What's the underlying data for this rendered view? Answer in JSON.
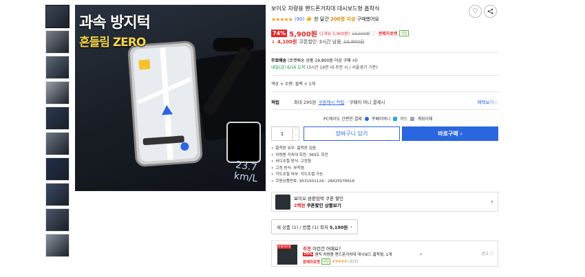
{
  "hero": {
    "headline1": "과속 방지턱",
    "headline2": "흔들림 ZERO",
    "speed_display": "23.7 km/L"
  },
  "thumbnails": [
    {
      "color": "#3a4656"
    },
    {
      "color": "#7a7f88"
    },
    {
      "color": "#5d6a7a"
    },
    {
      "color": "#9aa0a8"
    },
    {
      "color": "#2a3850"
    },
    {
      "color": "#6b7685"
    },
    {
      "color": "#1f2e4a"
    },
    {
      "color": "#3b4a64"
    },
    {
      "color": "#4a5668"
    },
    {
      "color": "#8a93a0"
    }
  ],
  "product": {
    "title": "보이오 차량용 핸드폰거치대 대시보드형 흡착식",
    "rating_stars": "★★★★★",
    "review_count": "(90)",
    "buy_note_prefix": "한 달간",
    "buy_note_count": "200명 이상",
    "buy_note_suffix": "구매했어요",
    "discount": "74%",
    "price": "5,900원",
    "unit_price": "(1개당 5,900원)",
    "original_price": "23,500원",
    "rocket_label": "판매자로켓",
    "rocket_sub": "내일",
    "coupon_arrow": "↓",
    "coupon_price": "4,100원",
    "coupon_label": "쿠폰할인",
    "coupon_time": "3시간 남음",
    "coupon_orig": "10,800원"
  },
  "shipping": {
    "label": "무료배송",
    "condition": "(로켓배송 상품 19,800원 이상 구매 시)",
    "arrival_green": "내일(금) 6/16 도착",
    "arrival_note": "(3시간 19분 내 주문 시 / 서울경기 기준)"
  },
  "options_text": "색상 × 수량: 블랙 × 1개",
  "points": {
    "label": "적립",
    "value": "최대 295원",
    "link": "쿠팡캐시 적립",
    "tail": "· 쿠페이 머니 결제시",
    "benefit": "혜택보기 ›"
  },
  "payment": {
    "prefix": "PC에서도 간편한 결제",
    "opt1": "쿠페이머니",
    "opt2": "카드",
    "opt3": "계좌이체"
  },
  "purchase": {
    "quantity": "1",
    "up": "˄",
    "down": "˅",
    "cart": "장바구니 담기",
    "buy": "바로구매 ›"
  },
  "specs": [
    "흡착판 유무: 흡착판 있음",
    "차량용 거치대 회전: 360도 회전",
    "비디조절 방식: 고정형",
    "고정 방식: 부착형",
    "각도조절 여부: 각도조절 가능",
    "쿠팡상품번호: 9531501124 - 28425078616"
  ],
  "coupon_card": {
    "line1": "보이오 완판임박 쿠폰 할인",
    "line2_red": "2백원",
    "line2": "쿠폰할인 상품보기",
    "chevron": "›"
  },
  "new_used": {
    "text": "새 상품 (1) / 반품 (1) 최저",
    "price": "5,190원",
    "chevron": "›"
  },
  "recommend": {
    "tag": "판매자로켓",
    "line1_red": "추천",
    "line1": "이런건 어때요?",
    "badge": "70%",
    "line2": "엠틱 차량용 핸드폰거치대 대시보드 흡착형, 1개",
    "rocket": "판매자로켓",
    "rocket_sub": "내일",
    "stars": "★★★★★",
    "count": "(323)",
    "chevron": "›",
    "ad": "광고 ⓘ"
  },
  "icons": {
    "heart": "♡",
    "share": "⋖"
  },
  "colors": {
    "accent": "#2a66e0",
    "sale": "#e52528",
    "star": "#f29a1f",
    "green": "#0a8f3c"
  }
}
